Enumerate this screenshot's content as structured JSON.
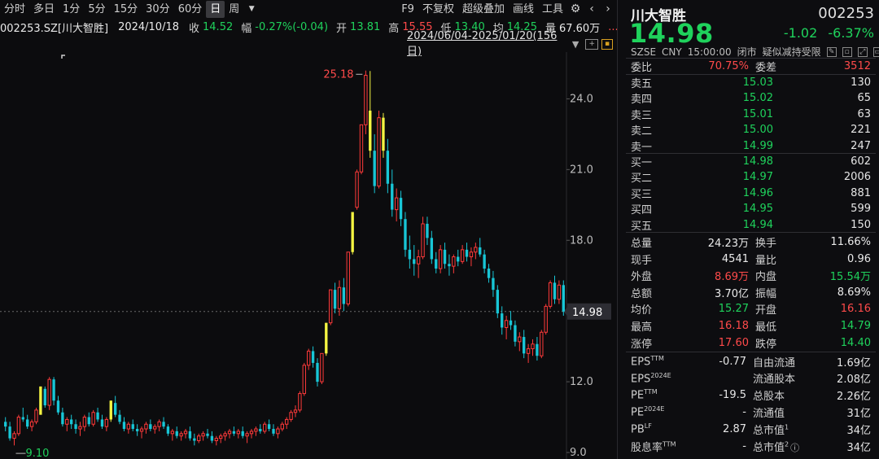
{
  "toolbar": {
    "periods": [
      "分时",
      "多日",
      "1分",
      "5分",
      "15分",
      "30分",
      "60分",
      "日",
      "周"
    ],
    "active_period": "日",
    "more_icon": "caret-down-icon",
    "actions": [
      "F9",
      "不复权",
      "超级叠加",
      "画线",
      "工具"
    ],
    "icons": [
      "gear-icon",
      "chevron-left-icon",
      "chevron-right-icon"
    ]
  },
  "info": {
    "code_name": "002253.SZ[川大智胜]",
    "date": "2024/10/18",
    "close_label": "收",
    "close": "14.52",
    "amp_label": "幅",
    "amp": "-0.27%(-0.04)",
    "open_label": "开",
    "open": "13.81",
    "high_label": "高",
    "high": "15.55",
    "low_label": "低",
    "low": "13.40",
    "avg_label": "均",
    "avg": "14.25",
    "amount_label": "量",
    "amount": "67.60万",
    "ellipsis": "...",
    "range": "2024/06/04-2025/01/20(156日)",
    "icons": [
      "minus-box-icon",
      "plus-box-icon",
      "lock-icon"
    ]
  },
  "chart_data": {
    "type": "candlestick",
    "y_ticks": [
      "24.0",
      "21.0",
      "18.0",
      "15.0",
      "12.0",
      "9.0"
    ],
    "ylim": [
      9.0,
      25.5
    ],
    "current_price_label": "14.98",
    "current_price": 14.98,
    "max_label": "25.18",
    "max_value": 25.18,
    "min_label": "9.10",
    "min_value": 9.1,
    "up_color": "#ff3a3a",
    "down_color": "#18c6d6",
    "limit_up_color": "#f5f542",
    "ohlc": [
      [
        10.3,
        10.5,
        9.9,
        10.1
      ],
      [
        10.1,
        10.3,
        9.5,
        9.6
      ],
      [
        9.6,
        9.9,
        9.3,
        9.8
      ],
      [
        9.8,
        10.6,
        9.7,
        10.5
      ],
      [
        10.5,
        10.9,
        10.3,
        10.4
      ],
      [
        10.4,
        10.6,
        10.0,
        10.1
      ],
      [
        10.1,
        10.4,
        9.9,
        10.3
      ],
      [
        10.3,
        10.9,
        10.2,
        10.8
      ],
      [
        10.6,
        11.8,
        10.6,
        11.8
      ],
      [
        11.7,
        11.8,
        10.9,
        11.0
      ],
      [
        11.0,
        12.2,
        10.8,
        12.1
      ],
      [
        12.1,
        12.2,
        11.0,
        11.2
      ],
      [
        11.2,
        11.4,
        10.6,
        10.7
      ],
      [
        10.7,
        10.9,
        10.1,
        10.2
      ],
      [
        10.2,
        10.5,
        9.9,
        10.4
      ],
      [
        10.4,
        10.6,
        10.0,
        10.2
      ],
      [
        10.2,
        10.4,
        9.8,
        10.0
      ],
      [
        10.0,
        10.3,
        9.7,
        10.1
      ],
      [
        10.1,
        10.6,
        9.9,
        10.5
      ],
      [
        10.5,
        10.7,
        10.1,
        10.2
      ],
      [
        10.2,
        10.8,
        10.1,
        10.7
      ],
      [
        10.7,
        10.9,
        10.3,
        10.4
      ],
      [
        10.4,
        10.6,
        10.0,
        10.1
      ],
      [
        10.1,
        10.5,
        9.9,
        10.4
      ],
      [
        10.4,
        11.2,
        10.3,
        11.2
      ],
      [
        11.1,
        11.4,
        10.5,
        10.6
      ],
      [
        10.6,
        10.8,
        10.2,
        10.3
      ],
      [
        10.3,
        10.5,
        9.9,
        10.0
      ],
      [
        10.0,
        10.3,
        9.8,
        10.2
      ],
      [
        10.2,
        10.4,
        9.9,
        10.0
      ],
      [
        10.0,
        10.2,
        9.7,
        9.9
      ],
      [
        9.9,
        10.1,
        9.6,
        10.0
      ],
      [
        10.0,
        10.3,
        9.8,
        10.2
      ],
      [
        10.2,
        10.4,
        9.9,
        10.0
      ],
      [
        10.0,
        10.2,
        9.8,
        10.1
      ],
      [
        10.1,
        10.4,
        9.9,
        10.3
      ],
      [
        10.3,
        10.5,
        10.0,
        10.1
      ],
      [
        10.1,
        10.2,
        9.7,
        9.8
      ],
      [
        9.8,
        10.0,
        9.5,
        9.9
      ],
      [
        9.9,
        10.1,
        9.6,
        9.7
      ],
      [
        9.7,
        9.9,
        9.5,
        9.8
      ],
      [
        9.8,
        10.0,
        9.6,
        9.9
      ],
      [
        9.9,
        10.1,
        9.5,
        9.6
      ],
      [
        9.6,
        9.8,
        9.3,
        9.5
      ],
      [
        9.5,
        9.8,
        9.4,
        9.7
      ],
      [
        9.7,
        9.9,
        9.5,
        9.8
      ],
      [
        9.8,
        10.0,
        9.6,
        9.7
      ],
      [
        9.7,
        9.9,
        9.4,
        9.5
      ],
      [
        9.5,
        9.7,
        9.3,
        9.6
      ],
      [
        9.6,
        9.8,
        9.4,
        9.7
      ],
      [
        9.7,
        9.9,
        9.5,
        9.8
      ],
      [
        9.8,
        10.0,
        9.6,
        9.9
      ],
      [
        9.9,
        10.1,
        9.7,
        9.8
      ],
      [
        9.8,
        10.0,
        9.6,
        9.9
      ],
      [
        9.9,
        10.1,
        9.6,
        9.7
      ],
      [
        9.7,
        9.9,
        9.4,
        9.8
      ],
      [
        9.8,
        10.0,
        9.6,
        9.9
      ],
      [
        9.9,
        10.1,
        9.7,
        10.0
      ],
      [
        10.0,
        10.2,
        9.8,
        9.9
      ],
      [
        9.9,
        10.3,
        9.8,
        10.2
      ],
      [
        10.2,
        10.4,
        9.9,
        10.0
      ],
      [
        10.0,
        10.2,
        9.7,
        9.8
      ],
      [
        9.8,
        10.1,
        9.6,
        10.0
      ],
      [
        10.0,
        10.3,
        9.9,
        10.2
      ],
      [
        10.2,
        10.5,
        10.0,
        10.4
      ],
      [
        10.4,
        10.8,
        10.3,
        10.7
      ],
      [
        10.7,
        11.0,
        10.5,
        10.8
      ],
      [
        10.8,
        11.6,
        10.7,
        11.5
      ],
      [
        11.5,
        12.8,
        11.4,
        12.7
      ],
      [
        12.7,
        13.4,
        12.5,
        13.3
      ],
      [
        13.3,
        13.5,
        12.6,
        12.8
      ],
      [
        12.8,
        13.0,
        11.8,
        12.0
      ],
      [
        12.0,
        13.2,
        11.9,
        13.2
      ],
      [
        13.2,
        14.5,
        13.1,
        14.5
      ],
      [
        14.5,
        15.9,
        14.4,
        15.9
      ],
      [
        15.9,
        16.2,
        14.9,
        15.1
      ],
      [
        15.1,
        16.3,
        14.8,
        16.0
      ],
      [
        16.0,
        16.4,
        15.0,
        15.3
      ],
      [
        15.3,
        17.5,
        15.2,
        17.5
      ],
      [
        17.5,
        19.2,
        17.4,
        19.2
      ],
      [
        19.4,
        21.0,
        19.3,
        20.9
      ],
      [
        20.9,
        22.9,
        20.8,
        22.9
      ],
      [
        22.9,
        25.2,
        22.5,
        25.0
      ],
      [
        23.5,
        25.18,
        21.5,
        21.8
      ],
      [
        21.8,
        22.5,
        20.0,
        20.3
      ],
      [
        20.3,
        23.5,
        20.2,
        23.2
      ],
      [
        23.2,
        23.4,
        21.5,
        21.8
      ],
      [
        21.8,
        22.3,
        20.0,
        20.4
      ],
      [
        20.4,
        21.0,
        19.0,
        19.3
      ],
      [
        19.3,
        20.2,
        18.8,
        19.8
      ],
      [
        19.8,
        20.1,
        18.6,
        18.9
      ],
      [
        18.9,
        19.2,
        17.3,
        17.6
      ],
      [
        17.6,
        18.2,
        16.8,
        17.2
      ],
      [
        17.2,
        17.8,
        16.5,
        17.0
      ],
      [
        17.0,
        17.6,
        16.4,
        17.3
      ],
      [
        17.3,
        19.0,
        17.2,
        18.7
      ],
      [
        18.7,
        19.0,
        17.8,
        18.1
      ],
      [
        18.1,
        18.4,
        17.0,
        17.2
      ],
      [
        17.2,
        17.5,
        16.6,
        16.8
      ],
      [
        16.8,
        17.8,
        16.6,
        17.6
      ],
      [
        17.6,
        17.9,
        16.8,
        17.0
      ],
      [
        17.0,
        17.4,
        16.5,
        16.9
      ],
      [
        16.9,
        17.4,
        16.6,
        17.3
      ],
      [
        17.3,
        17.6,
        16.9,
        17.1
      ],
      [
        17.1,
        17.8,
        17.0,
        17.6
      ],
      [
        17.6,
        17.9,
        17.1,
        17.3
      ],
      [
        17.3,
        17.7,
        16.9,
        17.5
      ],
      [
        17.5,
        17.9,
        17.2,
        17.7
      ],
      [
        17.7,
        18.1,
        17.3,
        17.4
      ],
      [
        17.4,
        17.6,
        16.6,
        16.8
      ],
      [
        16.8,
        17.0,
        16.2,
        16.4
      ],
      [
        16.4,
        16.7,
        15.6,
        15.9
      ],
      [
        15.9,
        16.1,
        14.7,
        14.9
      ],
      [
        14.9,
        15.2,
        14.0,
        14.3
      ],
      [
        14.3,
        14.8,
        13.8,
        14.6
      ],
      [
        14.6,
        15.0,
        14.2,
        14.4
      ],
      [
        14.4,
        14.6,
        13.5,
        13.7
      ],
      [
        13.7,
        14.1,
        13.3,
        13.9
      ],
      [
        13.9,
        14.2,
        13.0,
        13.2
      ],
      [
        13.2,
        13.6,
        12.8,
        13.4
      ],
      [
        13.4,
        13.8,
        13.1,
        13.6
      ],
      [
        13.6,
        13.9,
        12.9,
        13.1
      ],
      [
        13.1,
        14.2,
        13.0,
        14.1
      ],
      [
        14.1,
        15.3,
        14.0,
        15.2
      ],
      [
        15.2,
        16.3,
        15.1,
        16.2
      ],
      [
        16.2,
        16.5,
        15.3,
        15.5
      ],
      [
        15.5,
        16.3,
        15.3,
        16.1
      ],
      [
        16.1,
        16.3,
        14.8,
        14.98
      ]
    ],
    "limit_up_indices": [
      8,
      24,
      73,
      79,
      83,
      86
    ],
    "limit_down_indices": [
      84
    ]
  },
  "panel": {
    "name": "川大智胜",
    "code": "002253",
    "price": "14.98",
    "change": "-1.02",
    "change_pct": "-6.37%",
    "exchange": "SZSE",
    "currency": "CNY",
    "time": "15:00:00",
    "status": "闭市",
    "tag": "疑似减持受限",
    "tag_icons": [
      "pencil-icon",
      "window-icon",
      "fullscreen-icon",
      "restore-icon"
    ],
    "webi": {
      "label1": "委比",
      "value1": "70.75%",
      "label2": "委差",
      "value2": "3512"
    },
    "asks": [
      {
        "label": "卖五",
        "price": "15.03",
        "vol": "130"
      },
      {
        "label": "卖四",
        "price": "15.02",
        "vol": "65"
      },
      {
        "label": "卖三",
        "price": "15.01",
        "vol": "63"
      },
      {
        "label": "卖二",
        "price": "15.00",
        "vol": "221"
      },
      {
        "label": "卖一",
        "price": "14.99",
        "vol": "247"
      }
    ],
    "bids": [
      {
        "label": "买一",
        "price": "14.98",
        "vol": "602"
      },
      {
        "label": "买二",
        "price": "14.97",
        "vol": "2006"
      },
      {
        "label": "买三",
        "price": "14.96",
        "vol": "881"
      },
      {
        "label": "买四",
        "price": "14.95",
        "vol": "599"
      },
      {
        "label": "买五",
        "price": "14.94",
        "vol": "150"
      }
    ],
    "stats": [
      {
        "l1": "总量",
        "v1": "24.23万",
        "c1": "white",
        "l2": "换手",
        "v2": "11.66%",
        "c2": "white"
      },
      {
        "l1": "现手",
        "v1": "4541",
        "c1": "white",
        "l2": "量比",
        "v2": "0.96",
        "c2": "white"
      },
      {
        "l1": "外盘",
        "v1": "8.69万",
        "c1": "red",
        "l2": "内盘",
        "v2": "15.54万",
        "c2": "green"
      },
      {
        "l1": "总额",
        "v1": "3.70亿",
        "c1": "white",
        "l2": "振幅",
        "v2": "8.69%",
        "c2": "white"
      },
      {
        "l1": "均价",
        "v1": "15.27",
        "c1": "green",
        "l2": "开盘",
        "v2": "16.16",
        "c2": "red"
      },
      {
        "l1": "最高",
        "v1": "16.18",
        "c1": "red",
        "l2": "最低",
        "v2": "14.79",
        "c2": "green"
      },
      {
        "l1": "涨停",
        "v1": "17.60",
        "c1": "red",
        "l2": "跌停",
        "v2": "14.40",
        "c2": "green"
      }
    ],
    "fin": [
      {
        "l1": "EPS",
        "s1": "TTM",
        "v1": "-0.77",
        "l2": "自由流通",
        "s2": "",
        "v2": "1.69亿"
      },
      {
        "l1": "EPS",
        "s1": "2024E",
        "v1": "",
        "l2": "流通股本",
        "s2": "",
        "v2": "2.08亿"
      },
      {
        "l1": "PE",
        "s1": "TTM",
        "v1": "-19.5",
        "l2": "总股本",
        "s2": "",
        "v2": "2.26亿"
      },
      {
        "l1": "PE",
        "s1": "2024E",
        "v1": "-",
        "l2": "流通值",
        "s2": "",
        "v2": "31亿"
      },
      {
        "l1": "PB",
        "s1": "LF",
        "v1": "2.87",
        "l2": "总市值",
        "s2": "1",
        "v2": "34亿"
      },
      {
        "l1": "股息率",
        "s1": "TTM",
        "v1": "-",
        "l2": "总市值",
        "s2": "2",
        "v2": "34亿"
      }
    ],
    "info_icon": "info-circle-icon"
  }
}
